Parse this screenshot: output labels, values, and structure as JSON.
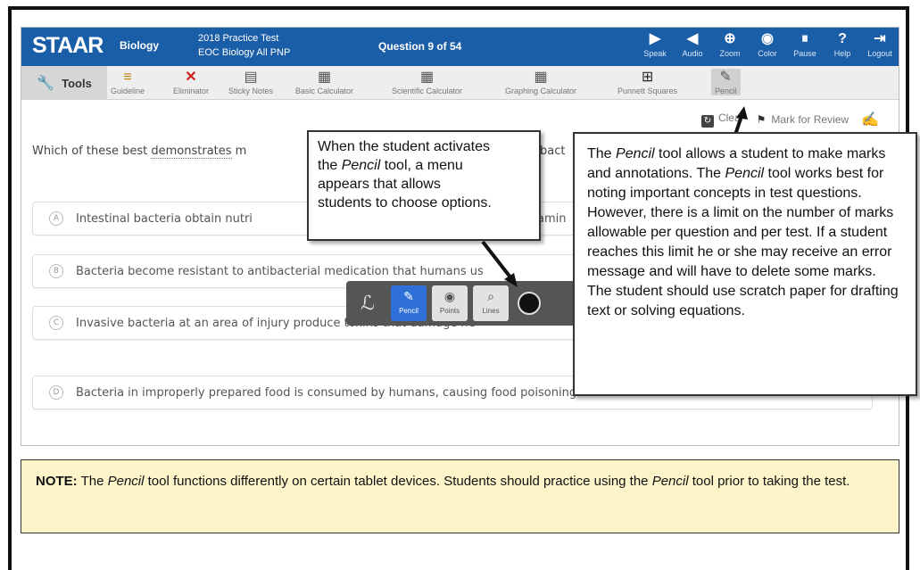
{
  "topbar": {
    "logo": "STAAR",
    "subject": "Biology",
    "test_line1": "2018 Practice Test",
    "test_line2": "EOC Biology All PNP",
    "question_count": "Question 9 of 54",
    "icons": [
      {
        "label": "Speak",
        "glyph": "▶"
      },
      {
        "label": "Audio",
        "glyph": "◀"
      },
      {
        "label": "Zoom",
        "glyph": "⊕"
      },
      {
        "label": "Color",
        "glyph": "◉"
      },
      {
        "label": "Pause",
        "glyph": "⏸"
      },
      {
        "label": "Help",
        "glyph": "?"
      },
      {
        "label": "Logout",
        "glyph": "⇥"
      }
    ]
  },
  "toolsbar": {
    "label": "Tools",
    "tools": [
      {
        "label": "Guideline",
        "glyph": "≡"
      },
      {
        "label": "Eliminator",
        "glyph": "✕"
      },
      {
        "label": "Sticky Notes",
        "glyph": "▤"
      },
      {
        "label": "Basic Calculator",
        "glyph": "▦"
      },
      {
        "label": "Scientific Calculator",
        "glyph": "▦"
      },
      {
        "label": "Graphing Calculator",
        "glyph": "▦"
      },
      {
        "label": "Punnett Squares",
        "glyph": "⊞"
      },
      {
        "label": "Pencil",
        "glyph": "✎"
      }
    ]
  },
  "actions": {
    "clear": "Clear",
    "mark_for_review": "Mark for Review"
  },
  "question": {
    "text_start": "Which of these best ",
    "text_dotted": "demonstrates",
    "text_end": " m",
    "text_right": "bact"
  },
  "options": [
    {
      "letter": "A",
      "text": "Intestinal bacteria obtain nutri",
      "tail": "amin"
    },
    {
      "letter": "B",
      "text": "Bacteria become resistant to antibacterial medication that humans us",
      "tail": ""
    },
    {
      "letter": "C",
      "text": "Invasive bacteria at an area of injury produce toxins that damage he",
      "tail": ""
    },
    {
      "letter": "D",
      "text": "Bacteria in improperly prepared food is consumed by humans, causing food poisoning.",
      "tail": ""
    }
  ],
  "pencil_menu": {
    "pencil": "Pencil",
    "points": "Points",
    "lines": "Lines"
  },
  "callout1": {
    "line1": "When the student activates",
    "line2_pre": "the ",
    "line2_italic": "Pencil",
    "line2_post": " tool, a menu",
    "line3": "appears that allows",
    "line4": "students to choose options."
  },
  "callout2": {
    "p1_pre": "The ",
    "p1_italic": "Pencil",
    "p1_mid": " tool allows a student to make marks and annotations. The ",
    "p1_italic2": "Pencil",
    "p1_post": " tool works best for noting important concepts in test questions. However, there is a limit on the number of marks allowable per question and per test. If a student reaches this limit he or she may receive an error message and will have to delete some marks. The student should use scratch paper for drafting text or solving equations."
  },
  "note": {
    "label": "NOTE:",
    "pre": " The ",
    "italic1": "Pencil",
    "mid": " tool functions differently on certain tablet devices. Students should practice using the ",
    "italic2": "Pencil",
    "post": " tool prior to taking the test."
  },
  "colors": {
    "topbar": "#1b5ea8",
    "note_bg": "#fdf5c9",
    "pencil_active": "#2f6fd8"
  }
}
